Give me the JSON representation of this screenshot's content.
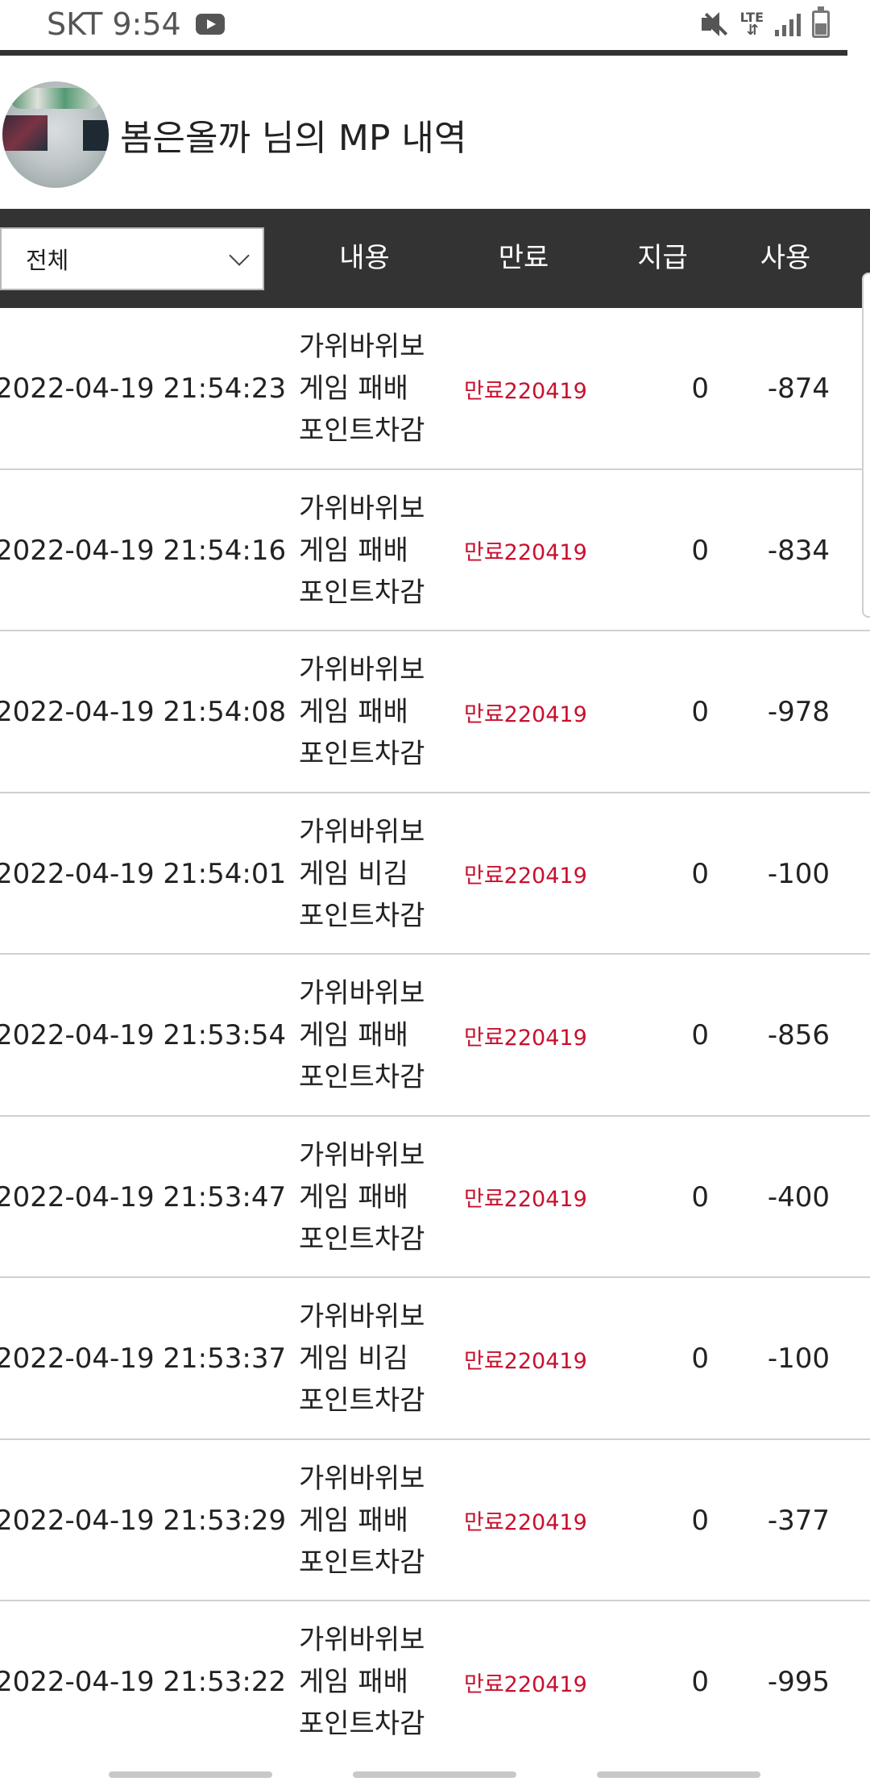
{
  "status_bar": {
    "carrier_time": "SKT 9:54",
    "network": "LTE"
  },
  "header": {
    "title": "봄은올까 님의 MP 내역"
  },
  "table": {
    "filter_selected": "전체",
    "columns": {
      "content": "내용",
      "expiry": "만료",
      "issued": "지급",
      "used": "사용"
    },
    "rows": [
      {
        "datetime": "2022-04-19 21:54:23",
        "content": [
          "가위바위보",
          "게임 패배",
          "포인트차감"
        ],
        "expiry": "만료220419",
        "issued": "0",
        "used": "-874"
      },
      {
        "datetime": "2022-04-19 21:54:16",
        "content": [
          "가위바위보",
          "게임 패배",
          "포인트차감"
        ],
        "expiry": "만료220419",
        "issued": "0",
        "used": "-834"
      },
      {
        "datetime": "2022-04-19 21:54:08",
        "content": [
          "가위바위보",
          "게임 패배",
          "포인트차감"
        ],
        "expiry": "만료220419",
        "issued": "0",
        "used": "-978"
      },
      {
        "datetime": "2022-04-19 21:54:01",
        "content": [
          "가위바위보",
          "게임 비김",
          "포인트차감"
        ],
        "expiry": "만료220419",
        "issued": "0",
        "used": "-100"
      },
      {
        "datetime": "2022-04-19 21:53:54",
        "content": [
          "가위바위보",
          "게임 패배",
          "포인트차감"
        ],
        "expiry": "만료220419",
        "issued": "0",
        "used": "-856"
      },
      {
        "datetime": "2022-04-19 21:53:47",
        "content": [
          "가위바위보",
          "게임 패배",
          "포인트차감"
        ],
        "expiry": "만료220419",
        "issued": "0",
        "used": "-400"
      },
      {
        "datetime": "2022-04-19 21:53:37",
        "content": [
          "가위바위보",
          "게임 비김",
          "포인트차감"
        ],
        "expiry": "만료220419",
        "issued": "0",
        "used": "-100"
      },
      {
        "datetime": "2022-04-19 21:53:29",
        "content": [
          "가위바위보",
          "게임 패배",
          "포인트차감"
        ],
        "expiry": "만료220419",
        "issued": "0",
        "used": "-377"
      },
      {
        "datetime": "2022-04-19 21:53:22",
        "content": [
          "가위바위보",
          "게임 패배",
          "포인트차감"
        ],
        "expiry": "만료220419",
        "issued": "0",
        "used": "-995"
      }
    ]
  },
  "colors": {
    "header_bg": "#333333",
    "expiry_text": "#c8102e",
    "row_divider": "#d0d0d0"
  },
  "icons": [
    "youtube-icon",
    "mute-icon",
    "lte-icon",
    "signal-icon",
    "battery-icon",
    "chevron-down-icon"
  ]
}
